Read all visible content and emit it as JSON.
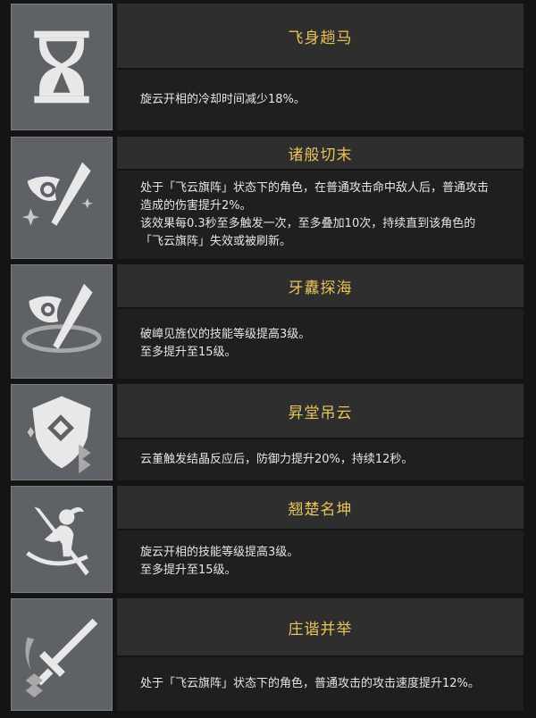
{
  "talents": [
    {
      "icon": "hourglass-icon",
      "title": "飞身趟马",
      "lines": [
        "旋云开相的冷却时间减少18%。"
      ]
    },
    {
      "icon": "fan-spear-icon",
      "title": "诸般切末",
      "lines": [
        "处于「飞云旗阵」状态下的角色，在普通攻击命中敌人后，普通攻击",
        "造成的伤害提升2%。",
        "该效果每0.3秒至多触发一次，至多叠加10次，持续直到该角色的",
        "「飞云旗阵」失效或被刷新。"
      ]
    },
    {
      "icon": "fan-spear-talent-icon",
      "title": "牙纛探海",
      "lines": [
        "破嶂见旌仪的技能等级提高3级。",
        "至多提升至15级。"
      ]
    },
    {
      "icon": "shield-crystal-icon",
      "title": "昇堂吊云",
      "lines": [
        "云堇触发结晶反应后，防御力提升20%，持续12秒。"
      ]
    },
    {
      "icon": "dancer-spear-icon",
      "title": "翘楚名坤",
      "lines": [
        "旋云开相的技能等级提高3级。",
        "至多提升至15级。"
      ]
    },
    {
      "icon": "sword-chevron-icon",
      "title": "庄谐并举",
      "lines": [
        "处于「飞云旗阵」状态下的角色，普通攻击的攻击速度提升12%。"
      ]
    }
  ]
}
